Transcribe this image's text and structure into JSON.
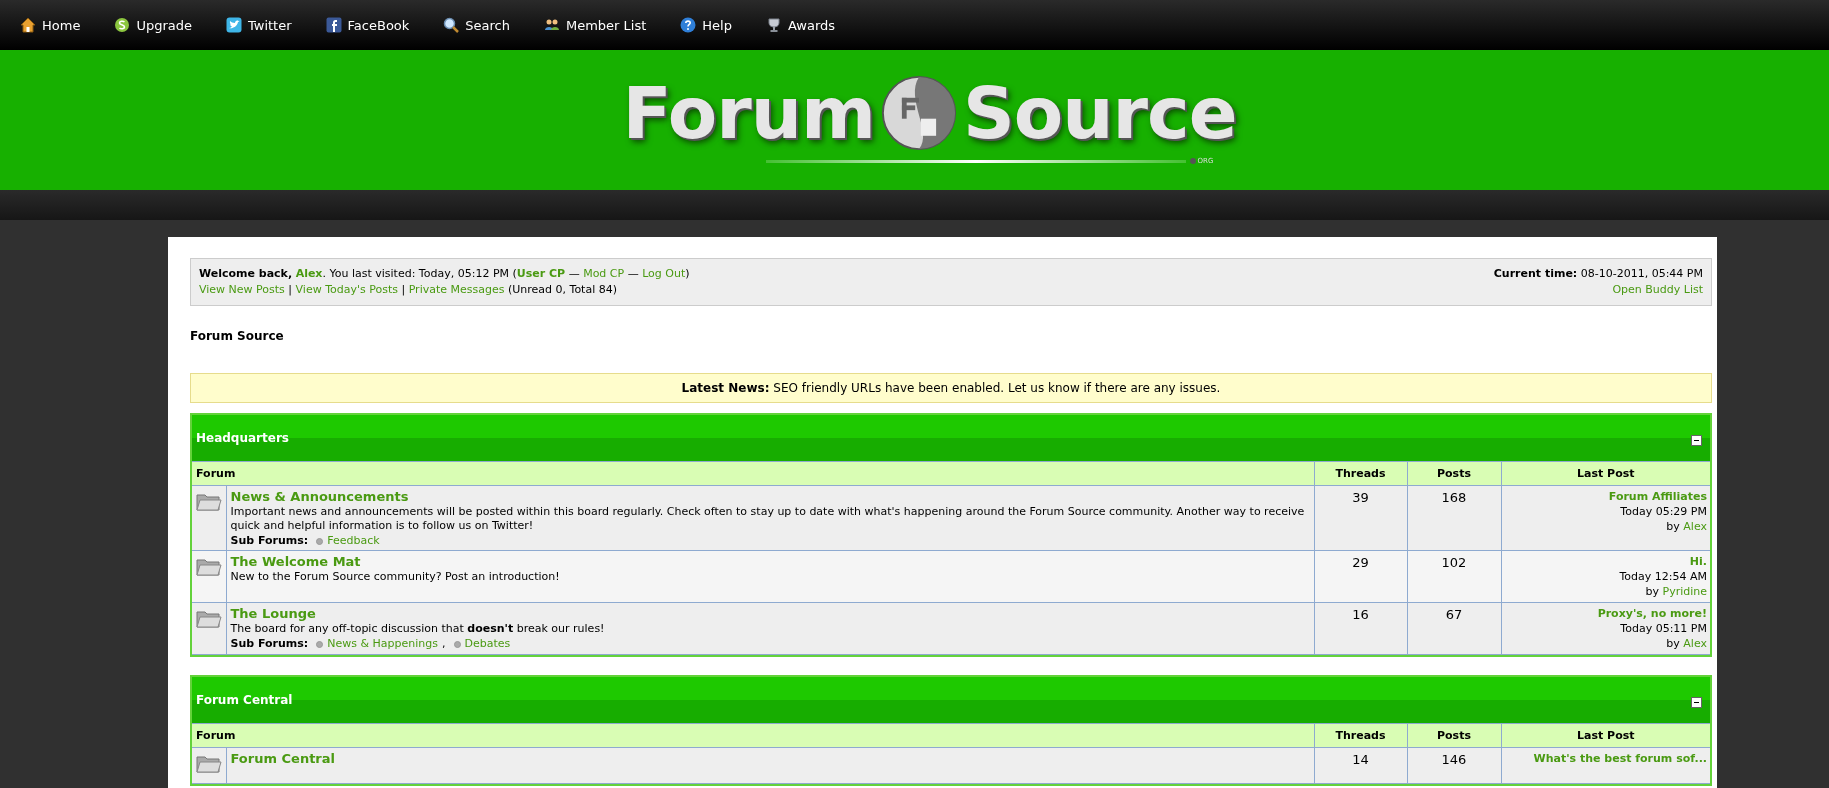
{
  "nav": [
    {
      "label": "Home",
      "kind": "home"
    },
    {
      "label": "Upgrade",
      "kind": "coin"
    },
    {
      "label": "Twitter",
      "kind": "bird"
    },
    {
      "label": "FaceBook",
      "kind": "tile"
    },
    {
      "label": "Search",
      "kind": "search"
    },
    {
      "label": "Member List",
      "kind": "users"
    },
    {
      "label": "Help",
      "kind": "help"
    },
    {
      "label": "Awards",
      "kind": "trophy"
    }
  ],
  "logo": {
    "left": "Forum",
    "right": "Source",
    "suffix": "ORG"
  },
  "welcome": {
    "line1": [
      {
        "kind": "text",
        "text": "**Welcome back,** "
      },
      {
        "kind": "link",
        "text": "Alex",
        "bold": true
      },
      {
        "kind": "text",
        "text": ". You last visited: Today, 05:12 PM ("
      },
      {
        "kind": "link",
        "text": "User CP",
        "bold": true
      },
      {
        "kind": "text",
        "text": " — "
      },
      {
        "kind": "link",
        "text": "Mod CP",
        "bold": false
      },
      {
        "kind": "text",
        "text": " — "
      },
      {
        "kind": "link",
        "text": "Log Out",
        "bold": false
      },
      {
        "kind": "text",
        "text": ")"
      }
    ],
    "line2": [
      {
        "kind": "link",
        "text": "View New Posts",
        "bold": false
      },
      {
        "kind": "text",
        "text": " | "
      },
      {
        "kind": "link",
        "text": "View Today's Posts",
        "bold": false
      },
      {
        "kind": "text",
        "text": " | "
      },
      {
        "kind": "link",
        "text": "Private Messages",
        "bold": false
      },
      {
        "kind": "text",
        "text": " (Unread 0, Total 84)"
      }
    ],
    "time": "**Current time:** 08-10-2011, 05:44 PM",
    "buddy_link": "Open Buddy List"
  },
  "breadcrumb": "Forum Source",
  "news": "**Latest News:** SEO friendly URLs have been enabled. Let us know if there are any issues.",
  "categories": [
    {
      "title": "Headquarters",
      "columns": [
        "Forum",
        "Threads",
        "Posts",
        "Last Post"
      ],
      "forums": [
        {
          "title": "News & Announcements",
          "description": "Important news and announcements will be posted within this board regularly. Check often to stay up to date with what's happening around the Forum Source community. Another way to receive quick and helpful information is to follow us on Twitter!",
          "subforums_label": "Sub Forums:",
          "subforums": [
            {
              "name": "Feedback"
            }
          ],
          "threads": "39",
          "posts": "168",
          "last_post": {
            "title": "Forum Affiliates",
            "time": "Today 05:29 PM",
            "by": "by",
            "author": "Alex"
          }
        },
        {
          "title": "The Welcome Mat",
          "description": "New to the Forum Source community? Post an introduction!",
          "threads": "29",
          "posts": "102",
          "last_post": {
            "title": "Hi.",
            "time": "Today 12:54 AM",
            "by": "by",
            "author": "Pyridine"
          }
        },
        {
          "title": "The Lounge",
          "description": "The board for any off-topic discussion that **doesn't** break our rules!",
          "subforums_label": "Sub Forums:",
          "subforums": [
            {
              "name": "News & Happenings",
              "sep": ","
            },
            {
              "name": "Debates"
            }
          ],
          "threads": "16",
          "posts": "67",
          "last_post": {
            "title": "Proxy's, no more!",
            "time": "Today 05:11 PM",
            "by": "by",
            "author": "Alex"
          }
        }
      ]
    },
    {
      "title": "Forum Central",
      "columns": [
        "Forum",
        "Threads",
        "Posts",
        "Last Post"
      ],
      "forums": [
        {
          "title": "Forum Central",
          "threads": "14",
          "posts": "146",
          "last_post": {
            "title": "What's the best forum sof..."
          }
        }
      ]
    }
  ]
}
